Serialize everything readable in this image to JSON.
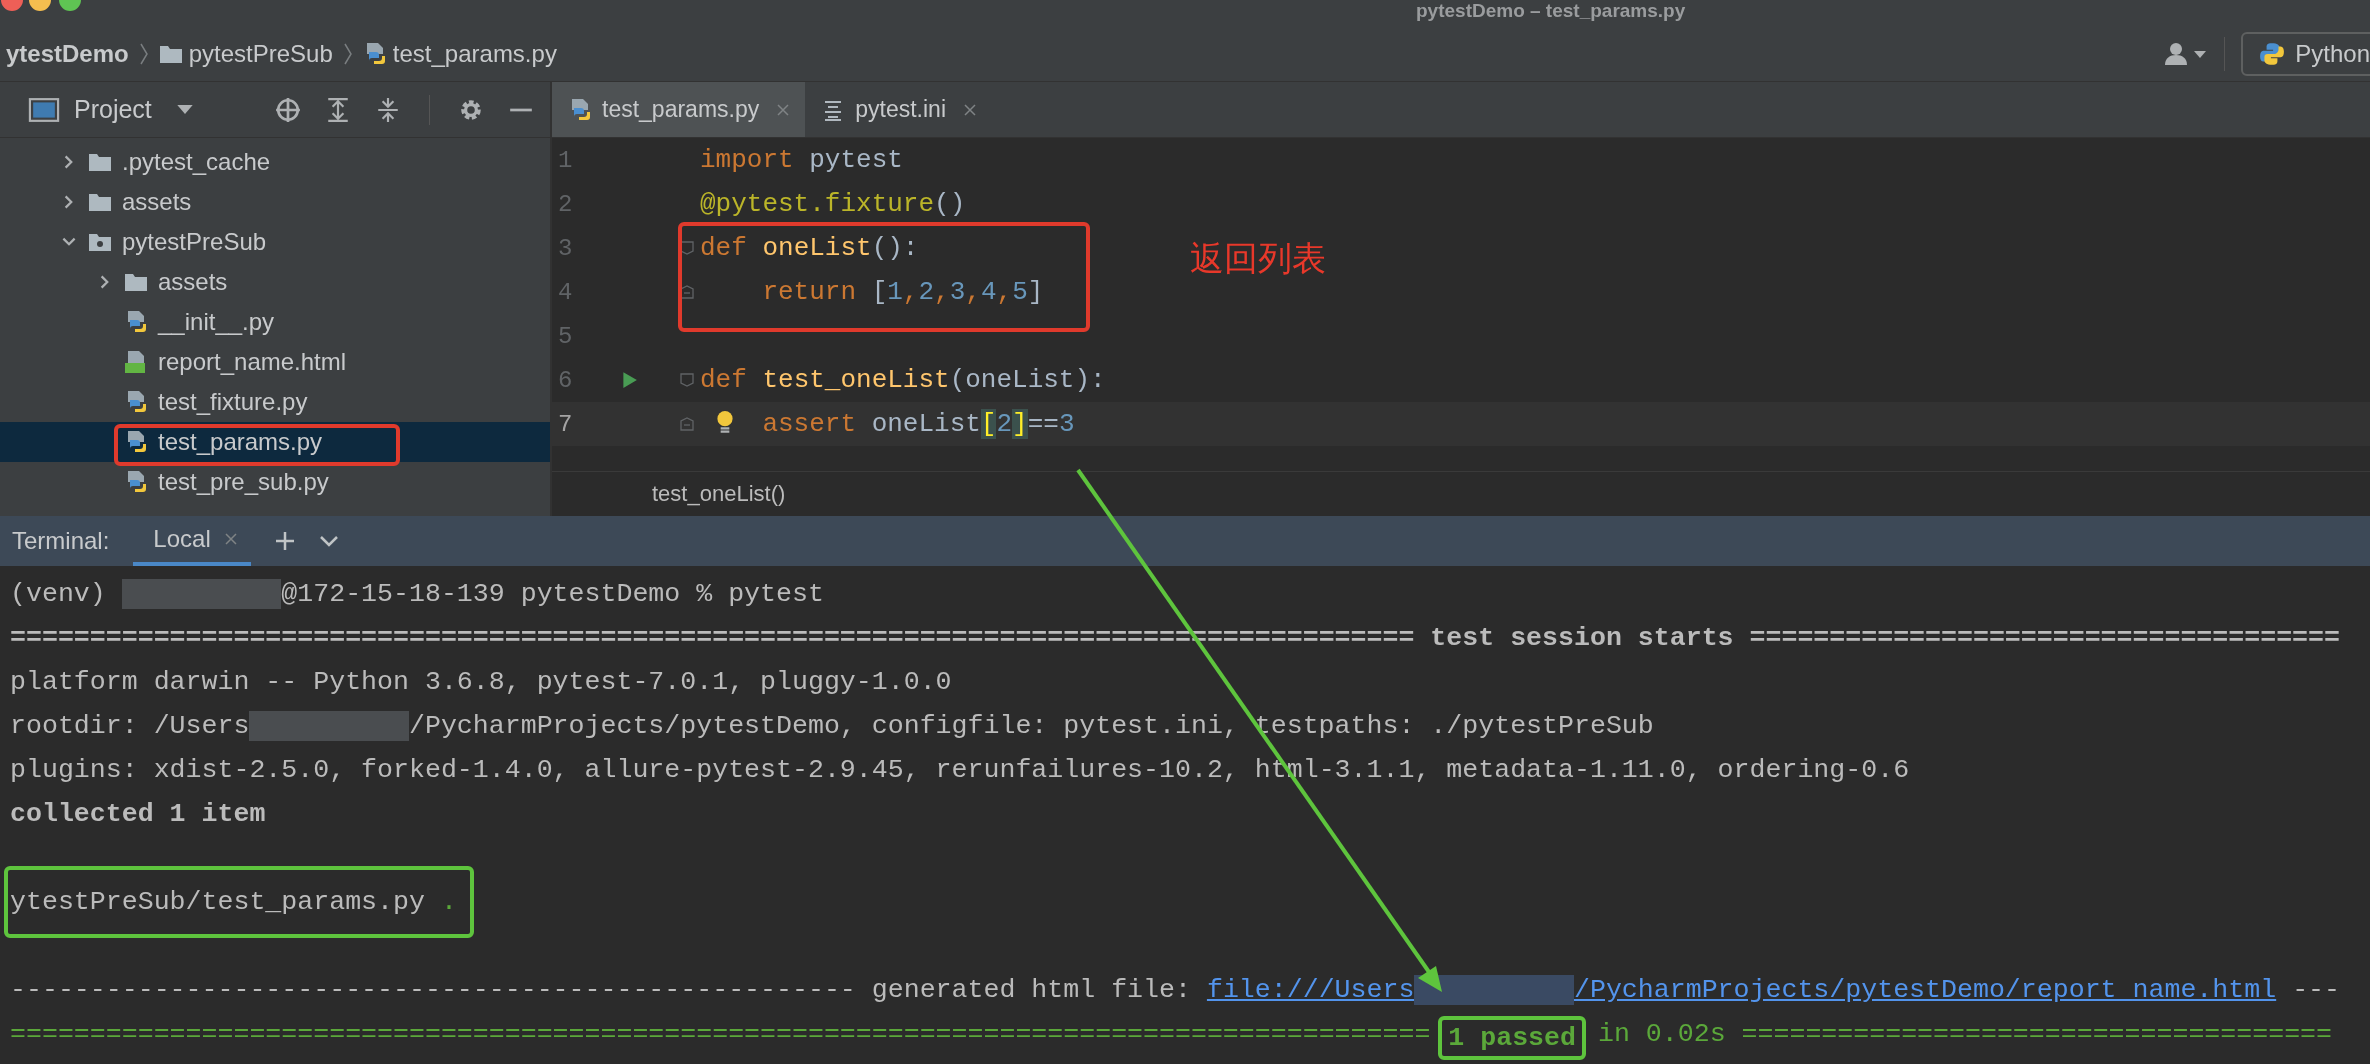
{
  "window": {
    "title": "pytestDemo – test_params.py"
  },
  "breadcrumb": [
    {
      "label": "ytestDemo",
      "kind": "project"
    },
    {
      "label": "pytestPreSub",
      "kind": "folder"
    },
    {
      "label": "test_params.py",
      "kind": "python"
    }
  ],
  "toolbar": {
    "run_config": "Python"
  },
  "project_panel": {
    "title": "Project",
    "tree": [
      {
        "label": ".pytest_cache",
        "kind": "folder",
        "expanded": false,
        "selected": false
      },
      {
        "label": "assets",
        "kind": "folder",
        "expanded": false,
        "selected": false
      },
      {
        "label": "pytestPreSub",
        "kind": "package",
        "expanded": true,
        "selected": false,
        "children": [
          {
            "label": "assets",
            "kind": "folder",
            "expanded": false,
            "selected": false
          },
          {
            "label": "__init__.py",
            "kind": "python",
            "selected": false
          },
          {
            "label": "report_name.html",
            "kind": "html",
            "selected": false
          },
          {
            "label": "test_fixture.py",
            "kind": "python",
            "selected": false
          },
          {
            "label": "test_params.py",
            "kind": "python",
            "selected": true
          },
          {
            "label": "test_pre_sub.py",
            "kind": "python",
            "selected": false
          }
        ]
      }
    ]
  },
  "editor": {
    "tabs": [
      {
        "label": "test_params.py",
        "kind": "python",
        "selected": true
      },
      {
        "label": "pytest.ini",
        "kind": "ini",
        "selected": false
      }
    ],
    "lines": [
      {
        "number": "1",
        "current": false,
        "kind": "plain",
        "tokens": [
          {
            "text": "import ",
            "kind": "keyword"
          },
          {
            "text": "pytest",
            "kind": "plain"
          }
        ]
      },
      {
        "number": "2",
        "current": false,
        "kind": "plain",
        "tokens": [
          {
            "text": "@pytest.fixture",
            "kind": "decorator"
          },
          {
            "text": "()",
            "kind": "plain"
          }
        ]
      },
      {
        "number": "3",
        "current": false,
        "kind": "fold-start",
        "tokens": [
          {
            "text": "def ",
            "kind": "keyword"
          },
          {
            "text": "oneList",
            "kind": "function"
          },
          {
            "text": "():",
            "kind": "plain"
          }
        ]
      },
      {
        "number": "4",
        "current": false,
        "kind": "fold-end",
        "tokens": [
          {
            "text": "    return ",
            "kind": "keyword"
          },
          {
            "text": "[",
            "kind": "plain"
          },
          {
            "text": "1",
            "kind": "number"
          },
          {
            "text": ",",
            "kind": "keyword"
          },
          {
            "text": "2",
            "kind": "number"
          },
          {
            "text": ",",
            "kind": "keyword"
          },
          {
            "text": "3",
            "kind": "number"
          },
          {
            "text": ",",
            "kind": "keyword"
          },
          {
            "text": "4",
            "kind": "number"
          },
          {
            "text": ",",
            "kind": "keyword"
          },
          {
            "text": "5",
            "kind": "number"
          },
          {
            "text": "]",
            "kind": "plain"
          }
        ]
      },
      {
        "number": "5",
        "current": false,
        "kind": "plain"
      },
      {
        "number": "6",
        "current": false,
        "kind": "run-fold-start",
        "tokens": [
          {
            "text": "def ",
            "kind": "keyword"
          },
          {
            "text": "test_oneList",
            "kind": "function"
          },
          {
            "text": "(oneList):",
            "kind": "plain"
          }
        ]
      },
      {
        "number": "7",
        "current": true,
        "kind": "bulb-fold-end",
        "tokens": [
          {
            "text": "    assert ",
            "kind": "keyword"
          },
          {
            "text": "oneList",
            "kind": "plain"
          },
          {
            "text": "[",
            "kind": "match"
          },
          {
            "text": "2",
            "kind": "number"
          },
          {
            "text": "]",
            "kind": "match"
          },
          {
            "text": "==",
            "kind": "plain"
          },
          {
            "text": "3",
            "kind": "number"
          }
        ]
      }
    ],
    "breadcrumb": "test_oneList()"
  },
  "annotation": {
    "note": "返回列表"
  },
  "terminal": {
    "title": "Terminal:",
    "tabs": [
      {
        "label": "Local",
        "selected": true
      }
    ],
    "lines": [
      {
        "segments": [
          {
            "kind": "text",
            "text": "(venv) "
          },
          {
            "kind": "redacted"
          },
          {
            "kind": "text",
            "text": "@172-15-18-139 pytestDemo % pytest"
          }
        ]
      },
      {
        "segments": [
          {
            "kind": "bold",
            "text": "======================================================================================== test session starts ====================================="
          }
        ]
      },
      {
        "segments": [
          {
            "kind": "text",
            "text": "platform darwin -- Python 3.6.8, pytest-7.0.1, pluggy-1.0.0"
          }
        ]
      },
      {
        "segments": [
          {
            "kind": "text",
            "text": "rootdir: /Users"
          },
          {
            "kind": "redacted"
          },
          {
            "kind": "text",
            "text": "/PycharmProjects/pytestDemo, configfile: pytest.ini, testpaths: ./pytestPreSub"
          }
        ]
      },
      {
        "segments": [
          {
            "kind": "text",
            "text": "plugins: xdist-2.5.0, forked-1.4.0, allure-pytest-2.9.45, rerunfailures-10.2, html-3.1.1, metadata-1.11.0, ordering-0.6"
          }
        ]
      },
      {
        "segments": [
          {
            "kind": "bold",
            "text": "collected 1 item"
          }
        ]
      },
      {
        "spaced": true,
        "boxed": true,
        "segments": [
          {
            "kind": "text",
            "text": "ytestPreSub/test_params.py "
          },
          {
            "kind": "green",
            "text": "."
          }
        ]
      },
      {
        "spaced": true,
        "segments": [
          {
            "kind": "text",
            "text": "----------------------------------------------------- generated html file: "
          },
          {
            "kind": "link",
            "parts": [
              "file:///Users",
              "/PycharmProjects/pytestDemo/report_name.html"
            ]
          },
          {
            "kind": "text",
            "text": " ---"
          }
        ]
      },
      {
        "segments": [
          {
            "kind": "green",
            "text": "========================================================================================= "
          },
          {
            "kind": "pass",
            "text": "1 passed",
            "boxed": true
          },
          {
            "kind": "green",
            "text": " in 0.02s ====================================="
          }
        ]
      }
    ]
  }
}
